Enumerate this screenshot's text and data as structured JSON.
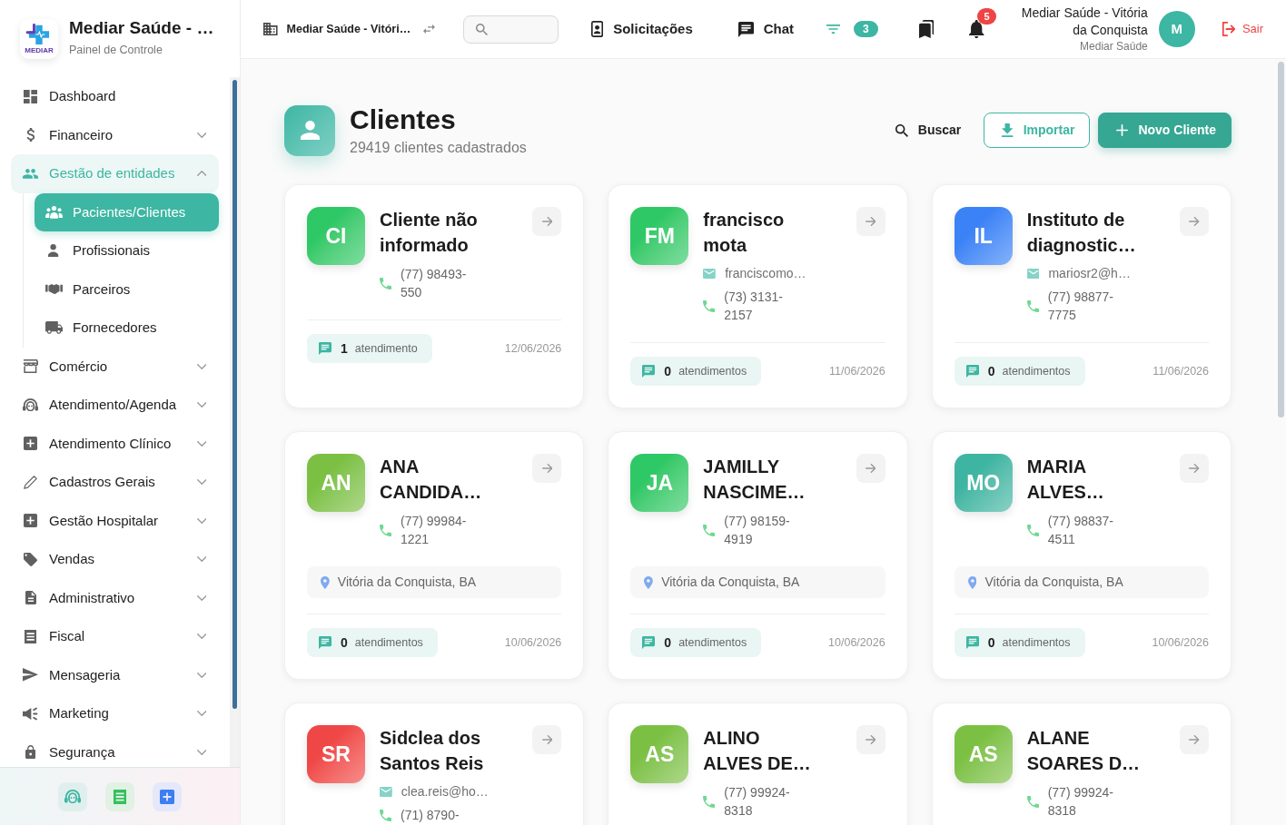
{
  "sidebar": {
    "brand": {
      "logo_text": "MEDIAR",
      "title": "Mediar Saúde - …",
      "subtitle": "Painel de Controle"
    },
    "items": [
      {
        "label": "Dashboard",
        "kind": "link",
        "selected": false
      },
      {
        "label": "Financeiro",
        "kind": "group",
        "expanded": false,
        "selected": false
      },
      {
        "label": "Gestão de entidades",
        "kind": "group",
        "expanded": true,
        "selected": true,
        "children": [
          {
            "label": "Pacientes/Clientes",
            "selected": true
          },
          {
            "label": "Profissionais",
            "selected": false
          },
          {
            "label": "Parceiros",
            "selected": false
          },
          {
            "label": "Fornecedores",
            "selected": false
          }
        ]
      },
      {
        "label": "Comércio",
        "kind": "group",
        "expanded": false,
        "selected": false
      },
      {
        "label": "Atendimento/Agenda",
        "kind": "group",
        "expanded": false,
        "selected": false
      },
      {
        "label": "Atendimento Clínico",
        "kind": "group",
        "expanded": false,
        "selected": false
      },
      {
        "label": "Cadastros Gerais",
        "kind": "group",
        "expanded": false,
        "selected": false
      },
      {
        "label": "Gestão Hospitalar",
        "kind": "group",
        "expanded": false,
        "selected": false
      },
      {
        "label": "Vendas",
        "kind": "group",
        "expanded": false,
        "selected": false
      },
      {
        "label": "Administrativo",
        "kind": "group",
        "expanded": false,
        "selected": false
      },
      {
        "label": "Fiscal",
        "kind": "group",
        "expanded": false,
        "selected": false
      },
      {
        "label": "Mensageria",
        "kind": "group",
        "expanded": false,
        "selected": false
      },
      {
        "label": "Marketing",
        "kind": "group",
        "expanded": false,
        "selected": false
      },
      {
        "label": "Segurança",
        "kind": "group",
        "expanded": false,
        "selected": false
      }
    ]
  },
  "topbar": {
    "unit": "Mediar Saúde - Vitóri…",
    "links": [
      {
        "label": "Solicitações"
      },
      {
        "label": "Chat"
      }
    ],
    "filter_count": "3",
    "notification_count": "5",
    "user": {
      "name": "Mediar Saúde - Vitória da Conquista",
      "organization": "Mediar Saúde",
      "initial": "M"
    },
    "logout": "Sair"
  },
  "page": {
    "title": "Clientes",
    "subtitle": "29419 clientes cadastrados",
    "actions": [
      {
        "label": "Buscar",
        "kind": "text"
      },
      {
        "label": "Importar",
        "kind": "outline"
      },
      {
        "label": "Novo Cliente",
        "kind": "primary"
      }
    ]
  },
  "clients": [
    {
      "initials": "CI",
      "color": "#2ec866",
      "name": "Cliente não informado",
      "phone": "(77) 98493-550",
      "count": "1",
      "count_label": "atendimento",
      "date": "12/06/2026"
    },
    {
      "initials": "FM",
      "color": "#2ec866",
      "name": "francisco mota",
      "email": "franciscomo…",
      "phone": "(73) 3131-2157",
      "count": "0",
      "count_label": "atendimentos",
      "date": "11/06/2026"
    },
    {
      "initials": "IL",
      "color": "#3b82f6",
      "name": "Instituto de diagnostic…",
      "email": "mariosr2@h…",
      "phone": "(77) 98877-7775",
      "count": "0",
      "count_label": "atendimentos",
      "date": "11/06/2026"
    },
    {
      "initials": "AN",
      "color": "#7cc043",
      "name": "ANA CANDIDA…",
      "phone": "(77) 99984-1221",
      "location": "Vitória da Conquista, BA",
      "count": "0",
      "count_label": "atendimentos",
      "date": "10/06/2026"
    },
    {
      "initials": "JA",
      "color": "#2ec866",
      "name": "JAMILLY NASCIME…",
      "phone": "(77) 98159-4919",
      "location": "Vitória da Conquista, BA",
      "count": "0",
      "count_label": "atendimentos",
      "date": "10/06/2026"
    },
    {
      "initials": "MO",
      "color": "#3eb5a2",
      "name": "MARIA ALVES…",
      "phone": "(77) 98837-4511",
      "location": "Vitória da Conquista, BA",
      "count": "0",
      "count_label": "atendimentos",
      "date": "10/06/2026"
    },
    {
      "initials": "SR",
      "color": "#ef4646",
      "name": "Sidclea dos Santos Reis",
      "email": "clea.reis@ho…",
      "phone": "(71) 8790-"
    },
    {
      "initials": "AS",
      "color": "#7cc043",
      "name": "ALINO ALVES DE…",
      "phone": "(77) 99924-8318"
    },
    {
      "initials": "AS",
      "color": "#7cc043",
      "name": "ALANE SOARES D…",
      "phone": "(77) 99924-8318"
    }
  ]
}
